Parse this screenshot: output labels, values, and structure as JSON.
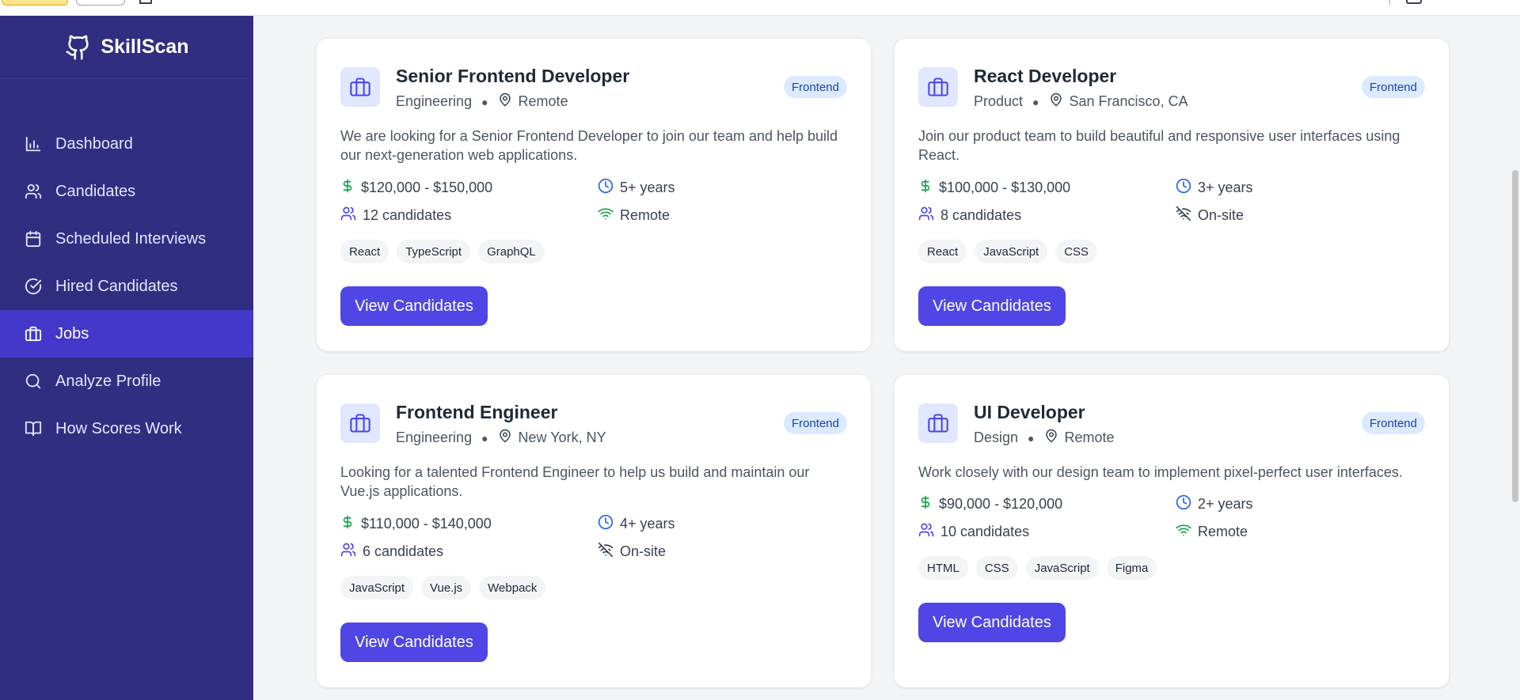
{
  "app": {
    "name": "SkillScan"
  },
  "sidebar": {
    "items": [
      {
        "label": "Dashboard",
        "icon": "bar-chart-icon",
        "active": false
      },
      {
        "label": "Candidates",
        "icon": "users-icon",
        "active": false
      },
      {
        "label": "Scheduled Interviews",
        "icon": "calendar-icon",
        "active": false
      },
      {
        "label": "Hired Candidates",
        "icon": "check-circle-icon",
        "active": false
      },
      {
        "label": "Jobs",
        "icon": "briefcase-icon",
        "active": true
      },
      {
        "label": "Analyze Profile",
        "icon": "search-icon",
        "active": false
      },
      {
        "label": "How Scores Work",
        "icon": "book-icon",
        "active": false
      }
    ]
  },
  "jobs": [
    {
      "title": "Senior Frontend Developer",
      "department": "Engineering",
      "location": "Remote",
      "badge": "Frontend",
      "description": "We are looking for a Senior Frontend Developer to join our team and help build our next-generation web applications.",
      "salary": "$120,000 - $150,000",
      "experience": "5+ years",
      "candidates": "12 candidates",
      "work_mode": "Remote",
      "tags": [
        "React",
        "TypeScript",
        "GraphQL"
      ],
      "button": "View Candidates"
    },
    {
      "title": "React Developer",
      "department": "Product",
      "location": "San Francisco, CA",
      "badge": "Frontend",
      "description": "Join our product team to build beautiful and responsive user interfaces using React.",
      "salary": "$100,000 - $130,000",
      "experience": "3+ years",
      "candidates": "8 candidates",
      "work_mode": "On-site",
      "tags": [
        "React",
        "JavaScript",
        "CSS"
      ],
      "button": "View Candidates"
    },
    {
      "title": "Frontend Engineer",
      "department": "Engineering",
      "location": "New York, NY",
      "badge": "Frontend",
      "description": "Looking for a talented Frontend Engineer to help us build and maintain our Vue.js applications.",
      "salary": "$110,000 - $140,000",
      "experience": "4+ years",
      "candidates": "6 candidates",
      "work_mode": "On-site",
      "tags": [
        "JavaScript",
        "Vue.js",
        "Webpack"
      ],
      "button": "View Candidates"
    },
    {
      "title": "UI Developer",
      "department": "Design",
      "location": "Remote",
      "badge": "Frontend",
      "description": "Work closely with our design team to implement pixel-perfect user interfaces.",
      "salary": "$90,000 - $120,000",
      "experience": "2+ years",
      "candidates": "10 candidates",
      "work_mode": "Remote",
      "tags": [
        "HTML",
        "CSS",
        "JavaScript",
        "Figma"
      ],
      "button": "View Candidates"
    }
  ],
  "colors": {
    "sidebar_bg": "#312e81",
    "sidebar_active": "#4338ca",
    "primary_button": "#4f46e5",
    "salary_icon": "#16a34a",
    "experience_icon": "#2563eb",
    "candidates_icon": "#4f46e5",
    "remote_icon": "#16a34a"
  }
}
